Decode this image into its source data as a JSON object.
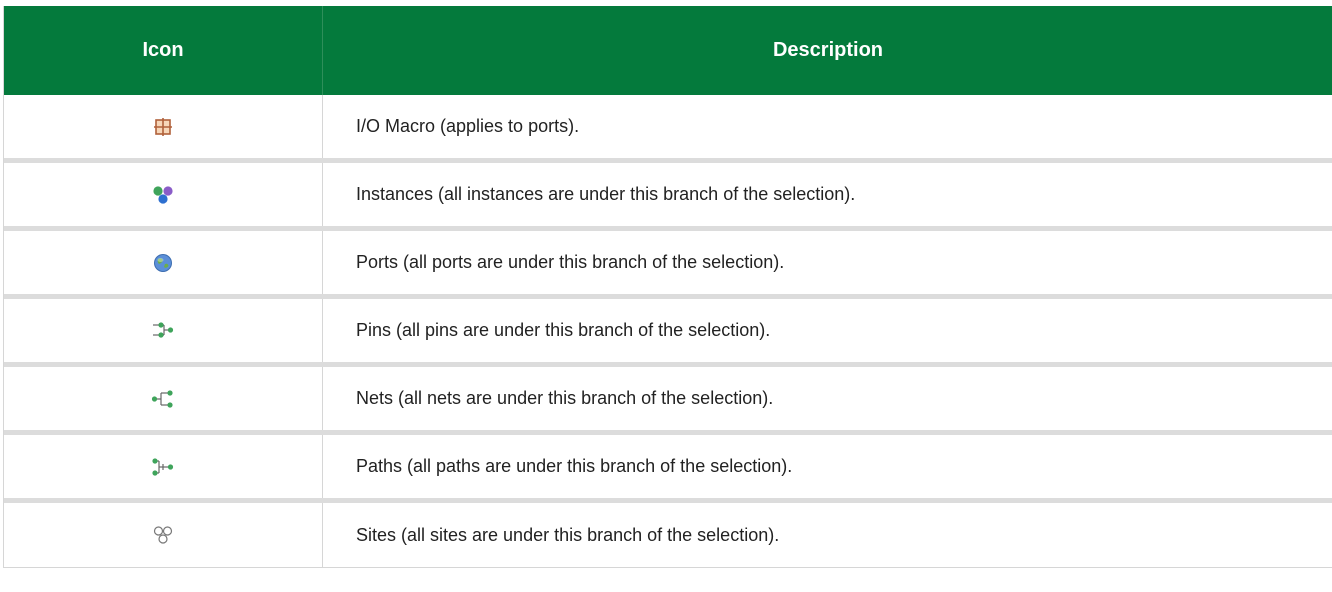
{
  "table": {
    "headers": {
      "icon": "Icon",
      "description": "Description"
    },
    "rows": [
      {
        "icon": "io-macro-icon",
        "description": "I/O Macro (applies to ports)."
      },
      {
        "icon": "instances-icon",
        "description": "Instances (all instances are under this branch of the selection)."
      },
      {
        "icon": "ports-globe-icon",
        "description": "Ports (all ports are under this branch of the selection)."
      },
      {
        "icon": "pins-icon",
        "description": "Pins (all pins are under this branch of the selection)."
      },
      {
        "icon": "nets-icon",
        "description": "Nets (all nets are under this branch of the selection)."
      },
      {
        "icon": "paths-icon",
        "description": "Paths (all paths are under this branch of the selection)."
      },
      {
        "icon": "sites-icon",
        "description": "Sites (all sites are under this branch of the selection)."
      }
    ]
  },
  "colors": {
    "header_bg": "#047a3c",
    "header_text": "#ffffff",
    "row_separator": "#dcdcdc"
  }
}
